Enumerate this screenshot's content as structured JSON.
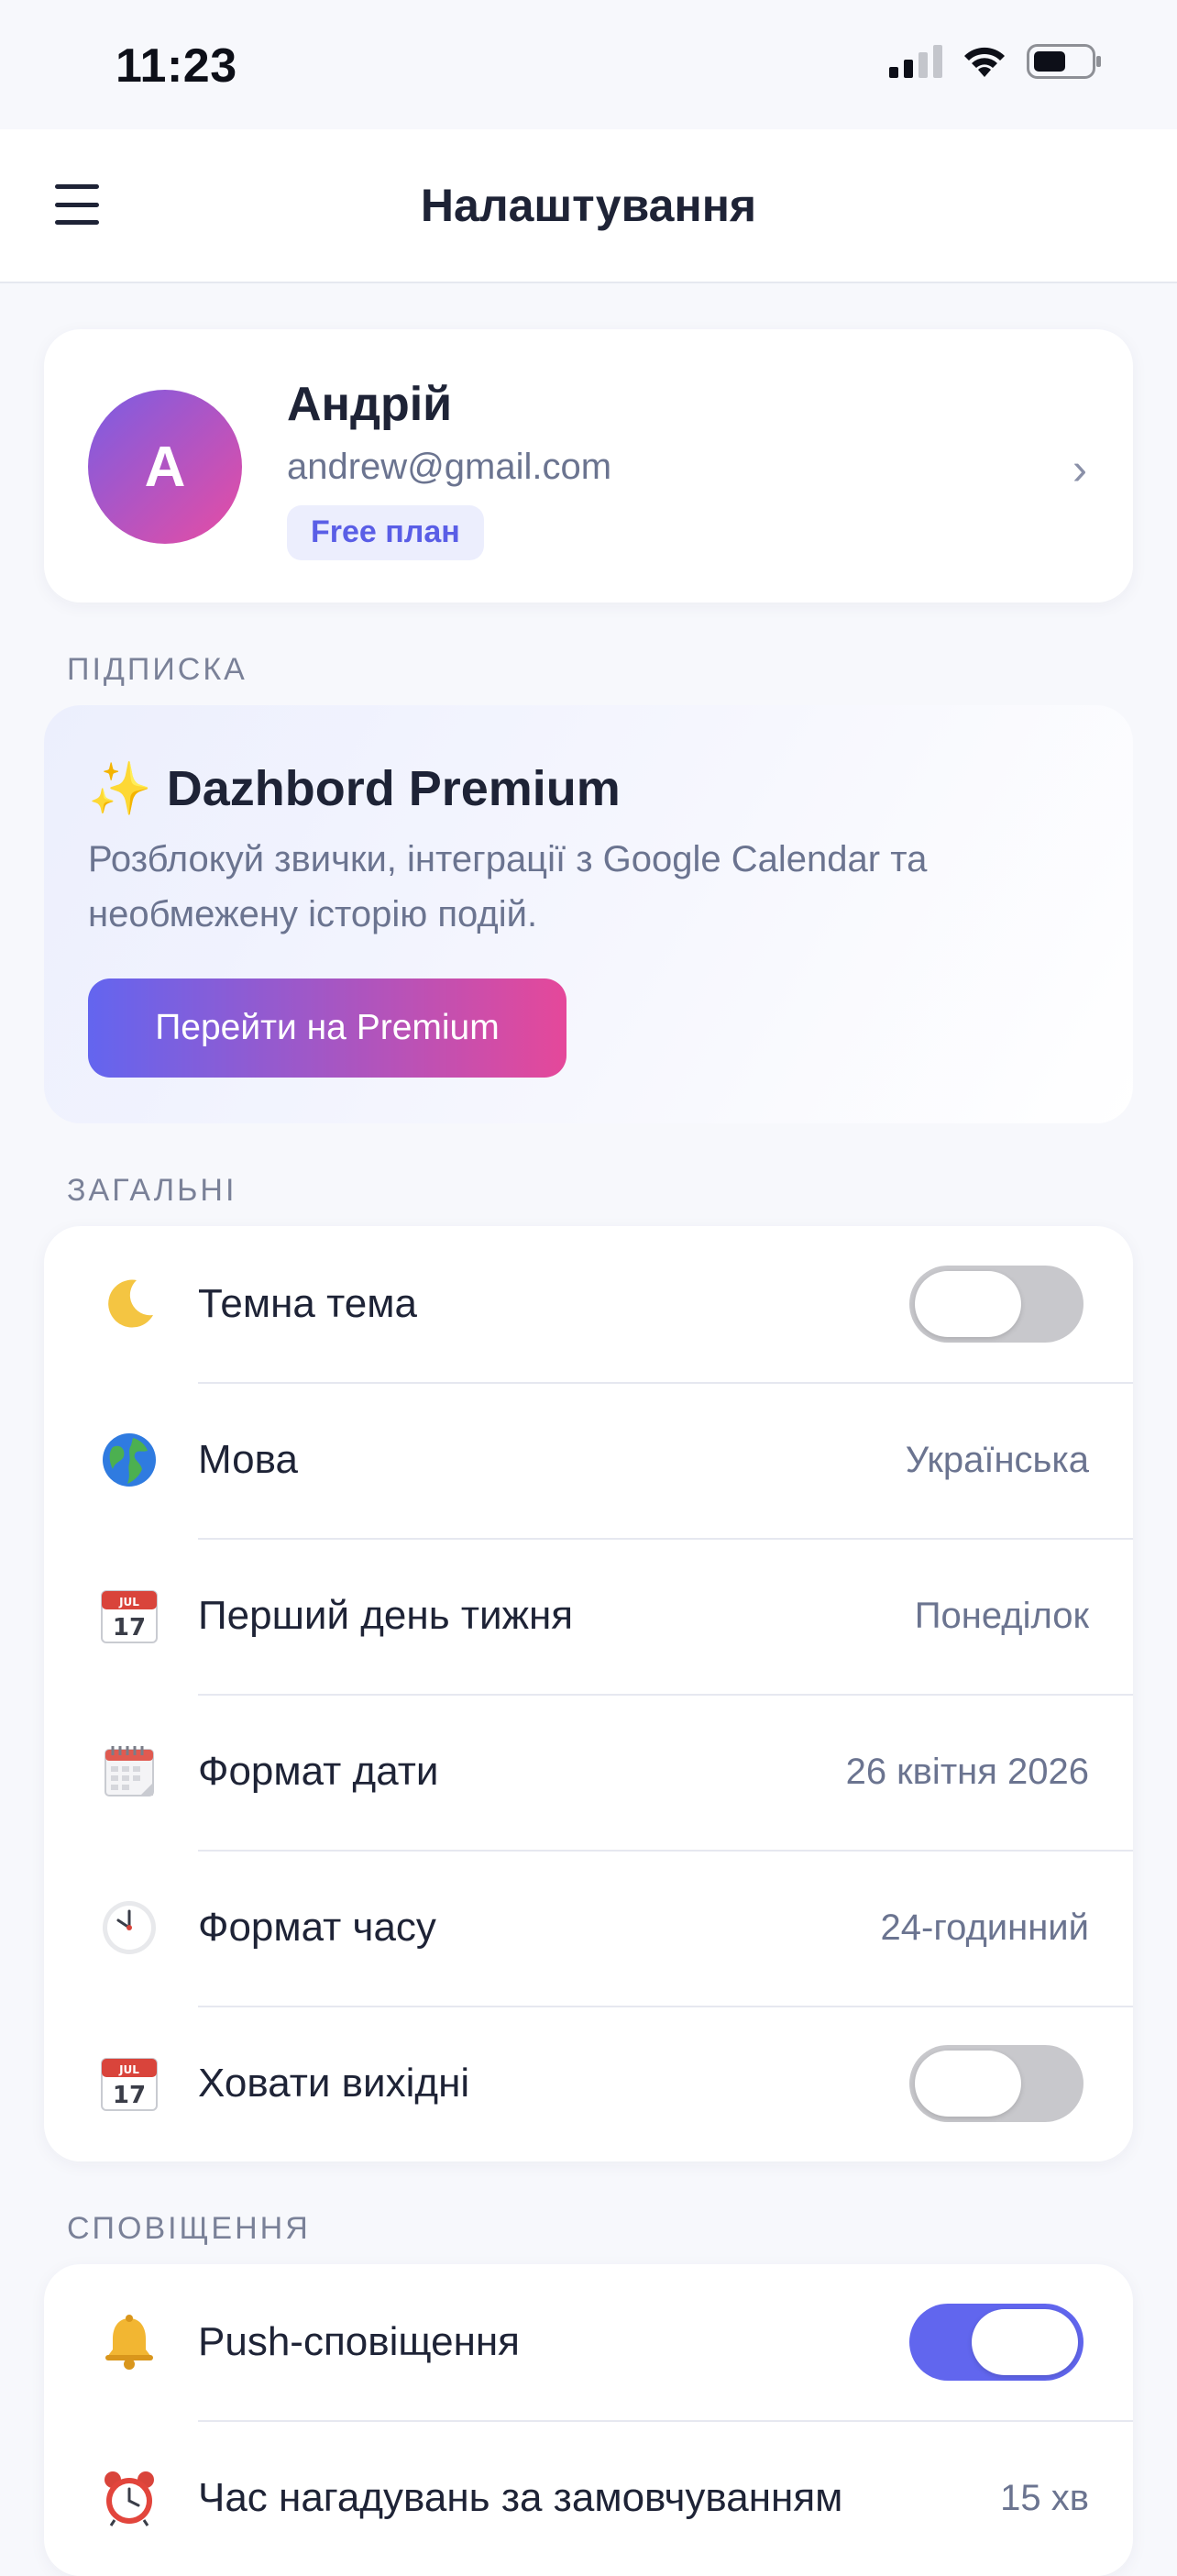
{
  "status_bar": {
    "time": "11:23"
  },
  "nav": {
    "title": "Налаштування"
  },
  "profile": {
    "avatar_letter": "A",
    "name": "Андрій",
    "email": "andrew@gmail.com",
    "plan": "Free план",
    "chevron": "›"
  },
  "subscription": {
    "section_label": "ПІДПИСКА",
    "title": "Dazhbord Premium",
    "sparkle": "✨",
    "description": "Розблокуй звички, інтеграції з Google Calendar та необмежену історію подій.",
    "button_label": "Перейти на Premium"
  },
  "general": {
    "section_label": "ЗАГАЛЬНІ",
    "rows": [
      {
        "icon": "moon-icon",
        "label": "Темна тема",
        "type": "toggle",
        "on": false
      },
      {
        "icon": "globe-icon",
        "label": "Мова",
        "type": "value",
        "value": "Українська"
      },
      {
        "icon": "calendar-icon",
        "label": "Перший день тижня",
        "type": "value",
        "value": "Понеділок"
      },
      {
        "icon": "spiral-calendar-icon",
        "label": "Формат дати",
        "type": "value",
        "value": "26 квітня 2026"
      },
      {
        "icon": "clock-icon",
        "label": "Формат часу",
        "type": "value",
        "value": "24-годинний"
      },
      {
        "icon": "calendar-icon",
        "label": "Ховати вихідні",
        "type": "toggle",
        "on": false
      }
    ],
    "calendar_icon_month": "JUL",
    "calendar_icon_day": "17"
  },
  "notifications": {
    "section_label": "СПОВІЩЕННЯ",
    "rows": [
      {
        "icon": "bell-icon",
        "label": "Push-сповіщення",
        "type": "toggle",
        "on": true
      },
      {
        "icon": "alarm-clock-icon",
        "label": "Час нагадувань за замовчуванням",
        "type": "value",
        "value": "15 хв"
      }
    ]
  },
  "colors": {
    "accent": "#6166ee",
    "gradient_end": "#e5489a",
    "toggle_off": "#c8c8cc"
  }
}
